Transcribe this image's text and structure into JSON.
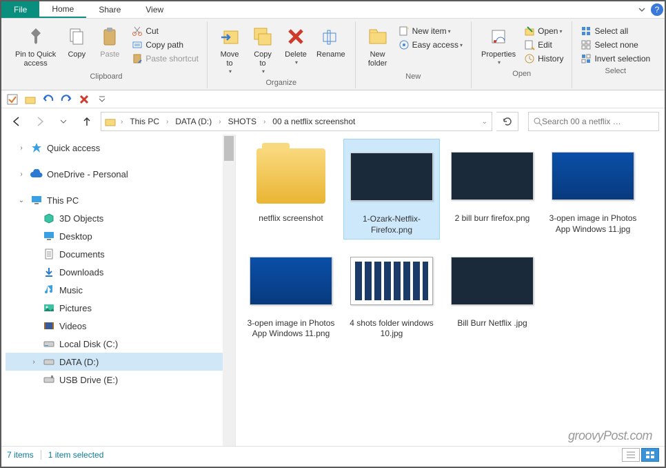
{
  "tabs": {
    "file": "File",
    "home": "Home",
    "share": "Share",
    "view": "View"
  },
  "ribbon": {
    "clipboard": {
      "label": "Clipboard",
      "pin": "Pin to Quick\naccess",
      "copy": "Copy",
      "paste": "Paste",
      "cut": "Cut",
      "copy_path": "Copy path",
      "paste_shortcut": "Paste shortcut"
    },
    "organize": {
      "label": "Organize",
      "move_to": "Move\nto",
      "copy_to": "Copy\nto",
      "delete": "Delete",
      "rename": "Rename"
    },
    "new": {
      "label": "New",
      "new_folder": "New\nfolder",
      "new_item": "New item",
      "easy_access": "Easy access"
    },
    "open": {
      "label": "Open",
      "properties": "Properties",
      "open": "Open",
      "edit": "Edit",
      "history": "History"
    },
    "select": {
      "label": "Select",
      "select_all": "Select all",
      "select_none": "Select none",
      "invert": "Invert selection"
    }
  },
  "breadcrumb": [
    "This PC",
    "DATA (D:)",
    "SHOTS",
    "00 a netflix screenshot"
  ],
  "search_placeholder": "Search 00 a netflix …",
  "sidebar": {
    "quick_access": "Quick access",
    "onedrive": "OneDrive - Personal",
    "this_pc": "This PC",
    "children": [
      "3D Objects",
      "Desktop",
      "Documents",
      "Downloads",
      "Music",
      "Pictures",
      "Videos",
      "Local Disk (C:)",
      "DATA (D:)",
      "USB Drive (E:)"
    ]
  },
  "files": [
    {
      "name": "netflix screenshot",
      "type": "folder"
    },
    {
      "name": "1-Ozark-Netflix-Firefox.png",
      "type": "dark",
      "selected": true
    },
    {
      "name": "2 bill burr firefox.png",
      "type": "dark"
    },
    {
      "name": "3-open image in Photos App Windows 11.jpg",
      "type": "blue"
    },
    {
      "name": "3-open image in Photos App Windows 11.png",
      "type": "blue"
    },
    {
      "name": "4 shots folder windows 10.jpg",
      "type": "explorer"
    },
    {
      "name": "Bill Burr Netflix .jpg",
      "type": "dark"
    }
  ],
  "status": {
    "count": "7 items",
    "selected": "1 item selected"
  },
  "watermark": "groovyPost.com"
}
